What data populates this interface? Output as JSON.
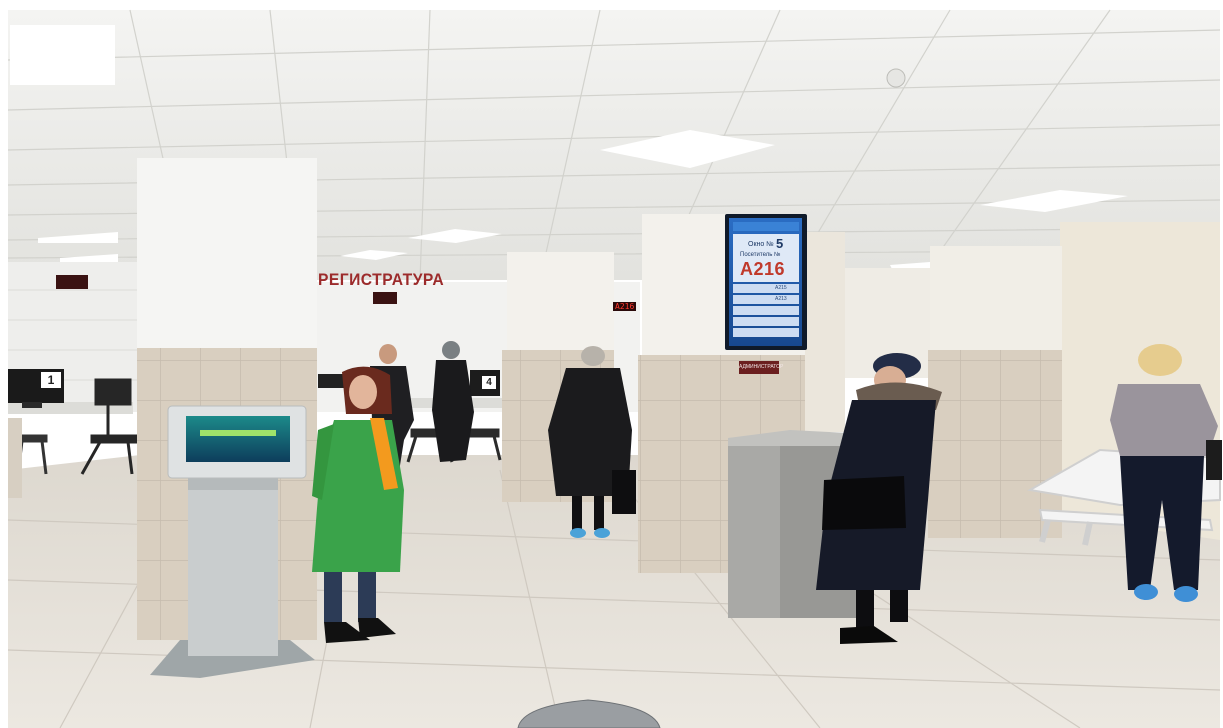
{
  "signs": {
    "registratura": "РЕГИСТРАТУРА",
    "window_1": "1",
    "window_4": "4",
    "led_ticket": "A216",
    "administrator": "АДМИНИСТРАТОР"
  },
  "queue_display": {
    "window_label": "Окно №",
    "window_number": "5",
    "visitor_label": "Посетитель №",
    "current_ticket": "A216",
    "rows": [
      {
        "ticket": "A215"
      },
      {
        "ticket": "A213"
      }
    ]
  },
  "colors": {
    "sign_red": "#9c2b2b",
    "screen_blue": "#1f5fb0",
    "uniform_green": "#3aa34a",
    "scarf_orange": "#f39a1e",
    "floor": "#e9e4dc",
    "ceiling": "#f1f1ee"
  }
}
